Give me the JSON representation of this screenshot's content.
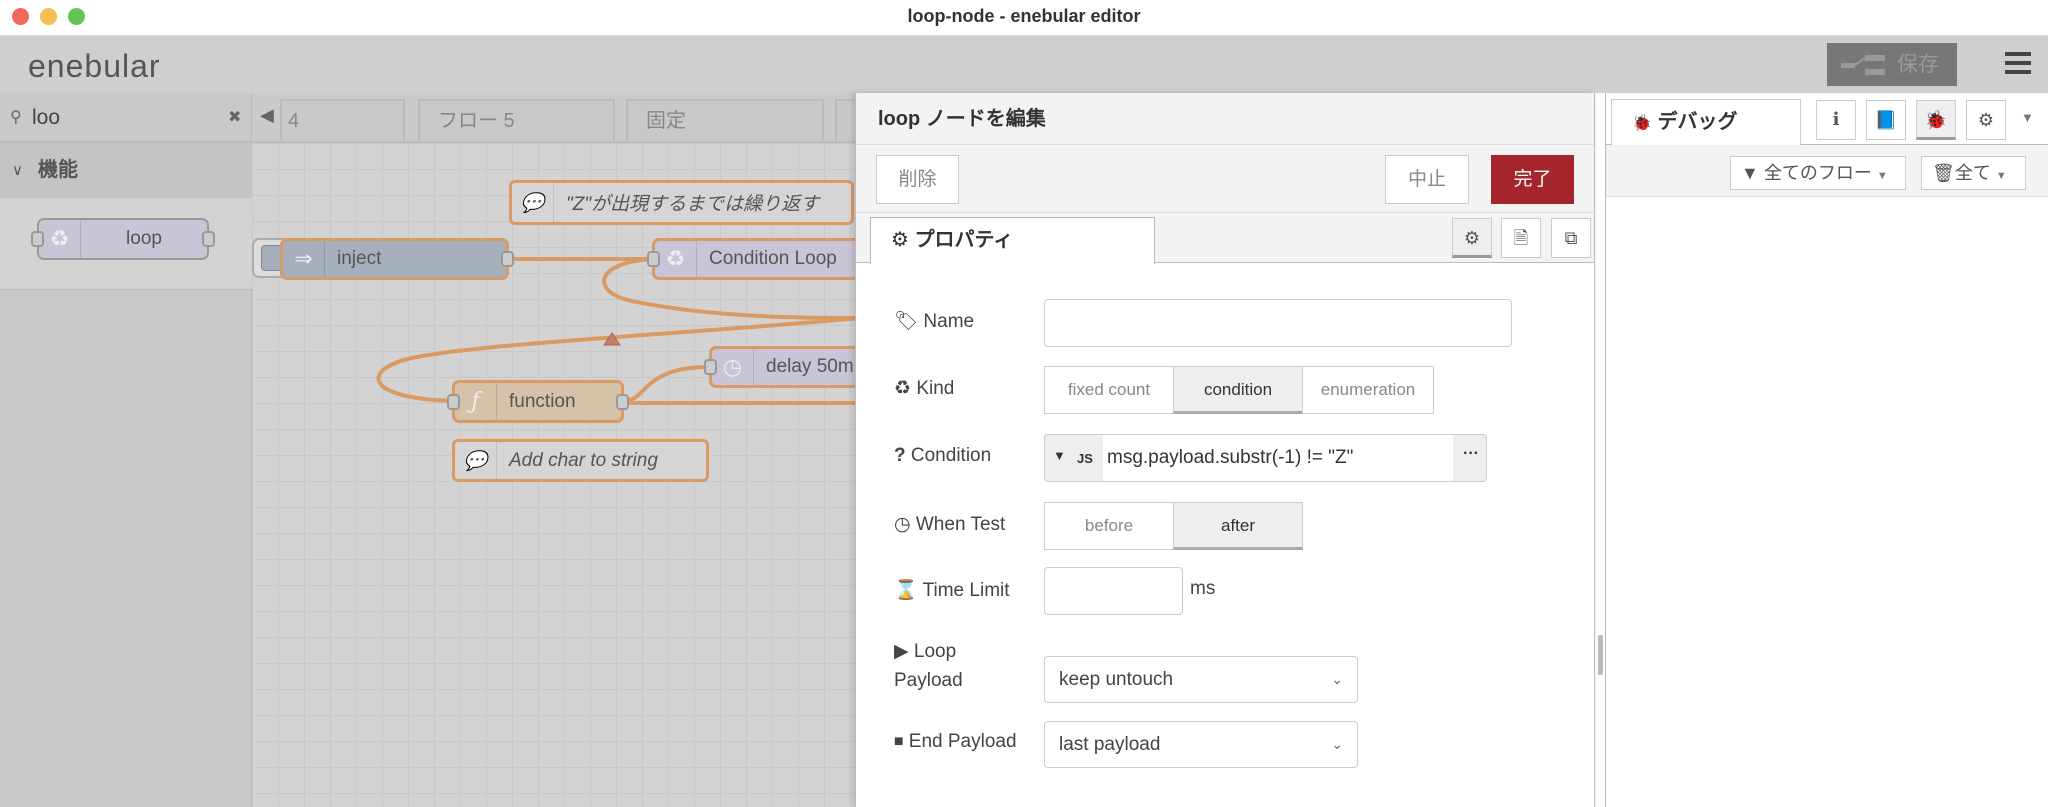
{
  "window": {
    "title": "loop-node - enebular editor"
  },
  "header": {
    "logo": "enebular",
    "save_label": "保存"
  },
  "palette": {
    "search_value": "loo",
    "category": "機能",
    "nodes": [
      {
        "label": "loop"
      }
    ]
  },
  "flow_tabs": [
    {
      "label": "4"
    },
    {
      "label": "フロー 5"
    },
    {
      "label": "固定"
    },
    {
      "label": ""
    }
  ],
  "canvas": {
    "comments": [
      {
        "text": "\"Z\"が出現するまでは繰り返す"
      },
      {
        "text": "Add char to string"
      }
    ],
    "nodes": [
      {
        "label": "inject"
      },
      {
        "label": "Condition Loop"
      },
      {
        "label": "delay 50m"
      },
      {
        "label": "function"
      }
    ]
  },
  "editor": {
    "title": "loop ノードを編集",
    "delete_label": "削除",
    "cancel_label": "中止",
    "done_label": "完了",
    "tab_label": "プロパティ",
    "fields": {
      "name": {
        "label": "Name",
        "value": ""
      },
      "kind": {
        "label": "Kind",
        "options": [
          "fixed count",
          "condition",
          "enumeration"
        ],
        "selected": "condition"
      },
      "condition": {
        "label": "Condition",
        "type": "JS",
        "value": "msg.payload.substr(-1) != \"Z\""
      },
      "when_test": {
        "label": "When Test",
        "options": [
          "before",
          "after"
        ],
        "selected": "after"
      },
      "time_limit": {
        "label": "Time Limit",
        "value": "",
        "unit": "ms"
      },
      "loop_payload": {
        "label_line1": "Loop",
        "label_line2": "Payload",
        "value": "keep untouch"
      },
      "end_payload": {
        "label": "End Payload",
        "value": "last payload"
      }
    }
  },
  "sidebar": {
    "tab_label": "デバッグ",
    "filter_label": "全てのフロー",
    "clear_label": "全て"
  },
  "colors": {
    "done": "#a4262c",
    "wire": "#d99a63",
    "loop_node": "#c9c5d6",
    "inject_node": "#a6b0bc",
    "function_node": "#d6c2a8"
  }
}
